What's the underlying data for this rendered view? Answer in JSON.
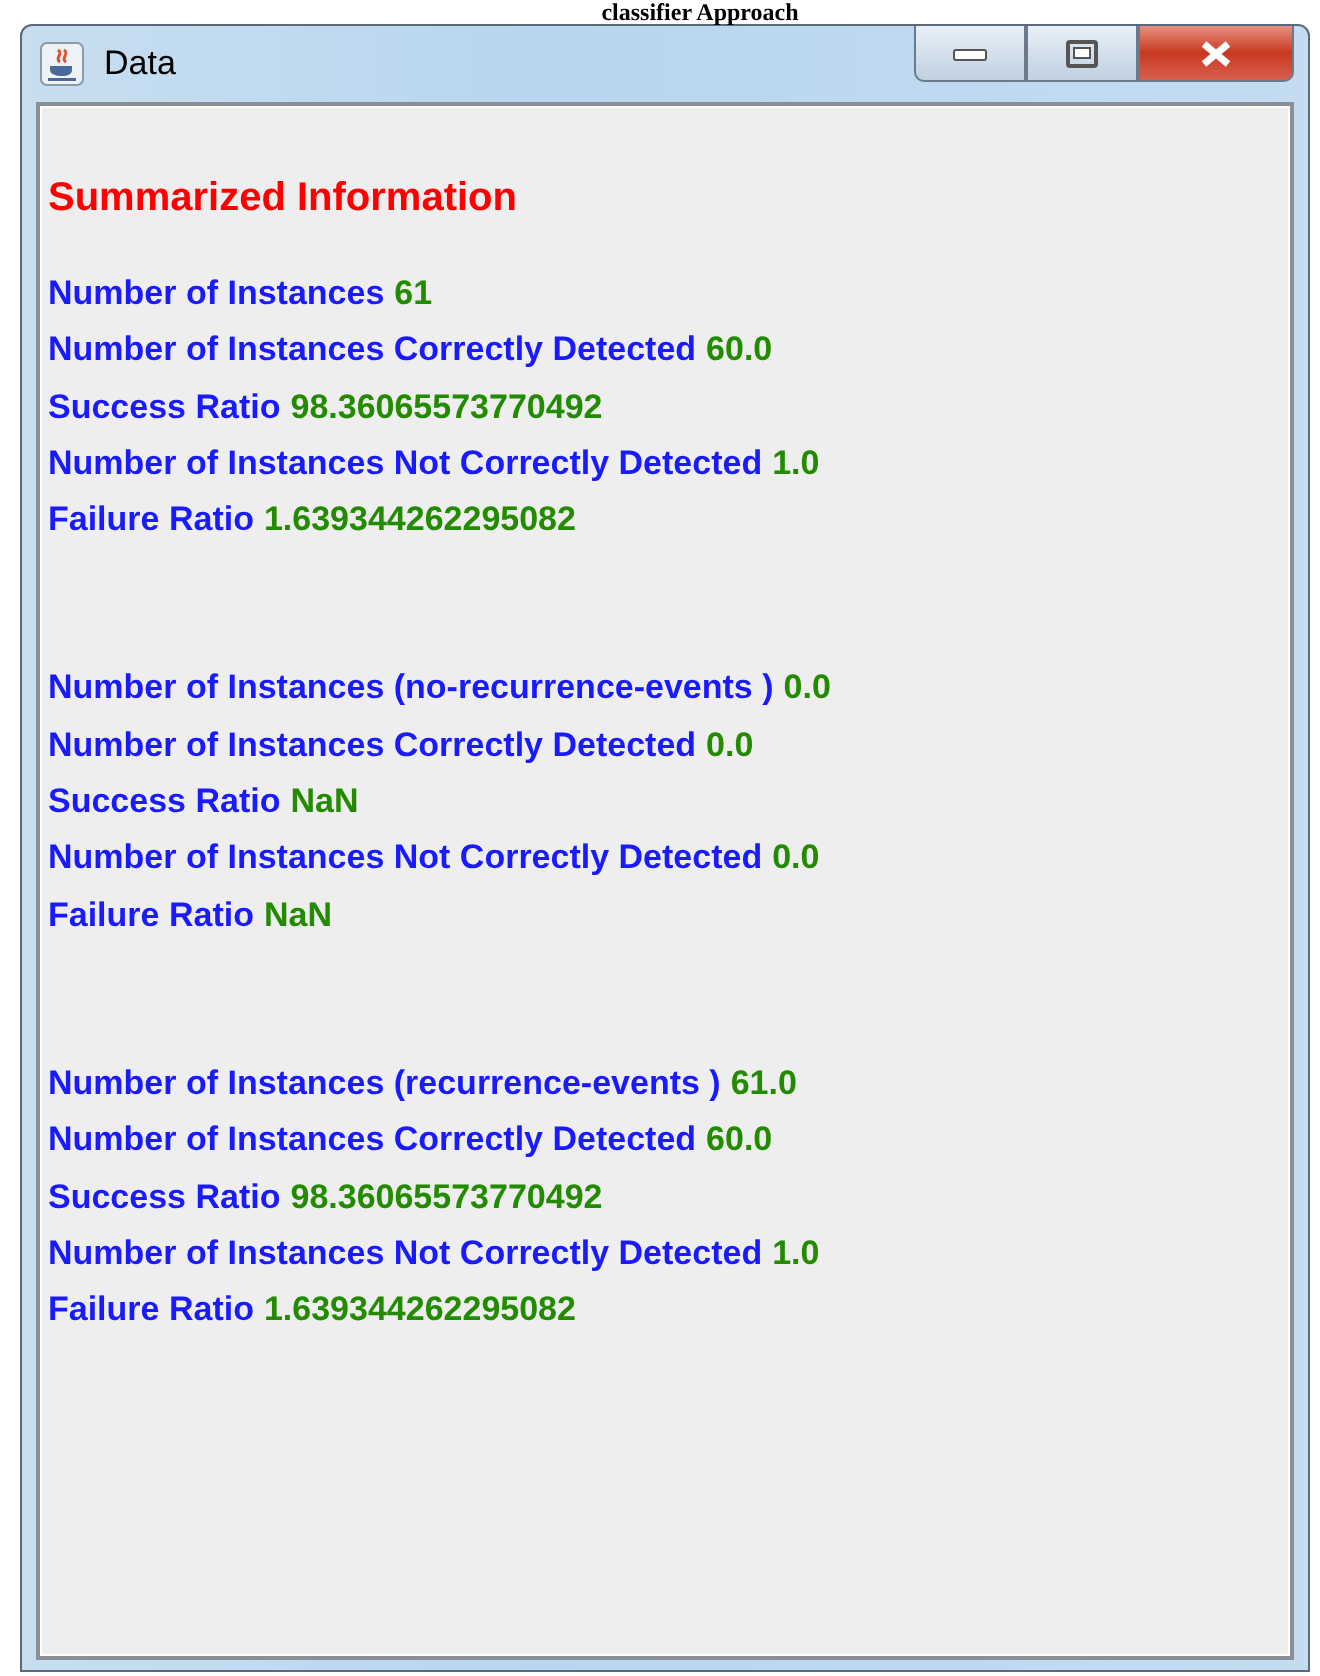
{
  "document_caption": "classifier Approach",
  "window": {
    "title": "Data"
  },
  "panel": {
    "heading": "Summarized Information",
    "sections": [
      {
        "lines": [
          {
            "label": "Number of Instances",
            "value": "61"
          },
          {
            "label": "Number of Instances Correctly Detected",
            "value": "60.0"
          },
          {
            "label": "Success Ratio",
            "value": "98.36065573770492"
          },
          {
            "label": "Number of Instances Not Correctly Detected",
            "value": "1.0"
          },
          {
            "label": "Failure Ratio",
            "value": "1.639344262295082"
          }
        ]
      },
      {
        "lines": [
          {
            "label": "Number of Instances (no-recurrence-events )",
            "value": "0.0"
          },
          {
            "label": "Number of Instances Correctly Detected",
            "value": "0.0"
          },
          {
            "label": "Success Ratio",
            "value": "NaN"
          },
          {
            "label": "Number of Instances Not Correctly Detected",
            "value": "0.0"
          },
          {
            "label": "Failure Ratio",
            "value": "NaN"
          }
        ]
      },
      {
        "lines": [
          {
            "label": "Number of Instances (recurrence-events )",
            "value": "61.0"
          },
          {
            "label": "Number of Instances Correctly Detected",
            "value": "60.0"
          },
          {
            "label": "Success Ratio",
            "value": "98.36065573770492"
          },
          {
            "label": "Number of Instances Not Correctly Detected",
            "value": "1.0"
          },
          {
            "label": "Failure Ratio",
            "value": "1.639344262295082"
          }
        ]
      }
    ]
  }
}
